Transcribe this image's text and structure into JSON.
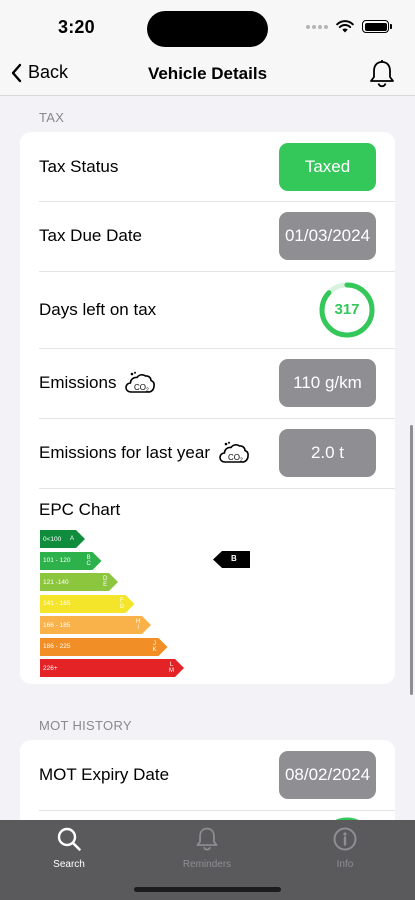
{
  "status": {
    "time": "3:20"
  },
  "nav": {
    "back_label": "Back",
    "title": "Vehicle Details"
  },
  "tax": {
    "section_title": "TAX",
    "status_label": "Tax Status",
    "status_value": "Taxed",
    "due_label": "Tax Due Date",
    "due_value": "01/03/2024",
    "days_label": "Days left on tax",
    "days_value": "317",
    "days_fraction": 0.87,
    "emissions_label": "Emissions",
    "emissions_value": "110 g/km",
    "emissions_year_label": "Emissions for last year",
    "emissions_year_value": "2.0 t",
    "epc_title": "EPC Chart",
    "epc_bands": [
      {
        "range": "0<100",
        "letters": "A",
        "color": "#0f8c3c"
      },
      {
        "range": "101 - 120",
        "letters": "B\nC",
        "color": "#2db14b"
      },
      {
        "range": "121 -140",
        "letters": "D\nE",
        "color": "#8cc63f"
      },
      {
        "range": "141 - 165",
        "letters": "F\nG",
        "color": "#f4e42a"
      },
      {
        "range": "166 - 185",
        "letters": "H\nI",
        "color": "#f9b14a"
      },
      {
        "range": "186 - 225",
        "letters": "J\nK",
        "color": "#f18e26"
      },
      {
        "range": "226+",
        "letters": "L\nM",
        "color": "#e42326"
      }
    ],
    "epc_rating": "B"
  },
  "mot": {
    "section_title": "MOT HISTORY",
    "expiry_label": "MOT Expiry Date",
    "expiry_value": "08/02/2024"
  },
  "tabs": [
    {
      "label": "Search",
      "icon": "search-icon",
      "active": true
    },
    {
      "label": "Reminders",
      "icon": "bell-icon",
      "active": false
    },
    {
      "label": "Info",
      "icon": "info-icon",
      "active": false
    }
  ],
  "colors": {
    "accent_green": "#34c759",
    "pill_gray": "#8e8e93"
  }
}
